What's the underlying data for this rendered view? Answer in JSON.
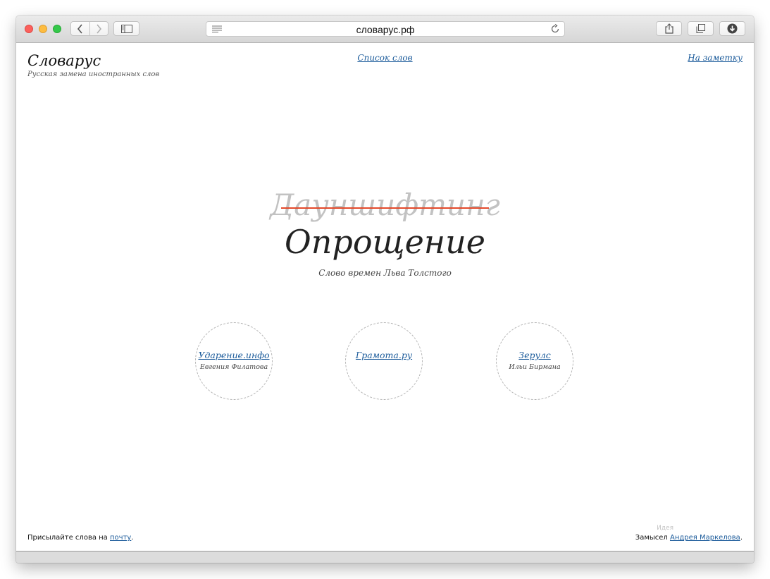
{
  "browser": {
    "address": "словарус.рф",
    "icons": {
      "back": "chevron-left-icon",
      "forward": "chevron-right-icon",
      "sidebar": "sidebar-icon",
      "reader": "reader-icon",
      "reload": "reload-icon",
      "share": "share-icon",
      "tabs": "tabs-icon",
      "downloads": "download-icon"
    }
  },
  "header": {
    "logo": "Словарус",
    "tagline": "Русская замена иностранных слов",
    "nav_center": "Список слов",
    "nav_right": "На заметку"
  },
  "main": {
    "old_word": "Дауншифтинг",
    "new_word": "Опрощение",
    "subtitle": "Слово времен Льва Толстого"
  },
  "links": [
    {
      "title": "Ударение.инфо",
      "author": "Евгения Филатова"
    },
    {
      "title": "Грамота.ру",
      "author": ""
    },
    {
      "title": "Зерулс",
      "author": "Ильи Бирмана"
    }
  ],
  "footer": {
    "left_prefix": "Присылайте слова на ",
    "left_link": "почту",
    "left_suffix": ".",
    "idea": "Идея",
    "right_prefix": "Замысел ",
    "right_link": "Андрея Маркелова",
    "right_suffix": "."
  },
  "colors": {
    "link": "#1a5a9a",
    "strike": "#e34a2b",
    "old_word": "#c2c2c2"
  }
}
